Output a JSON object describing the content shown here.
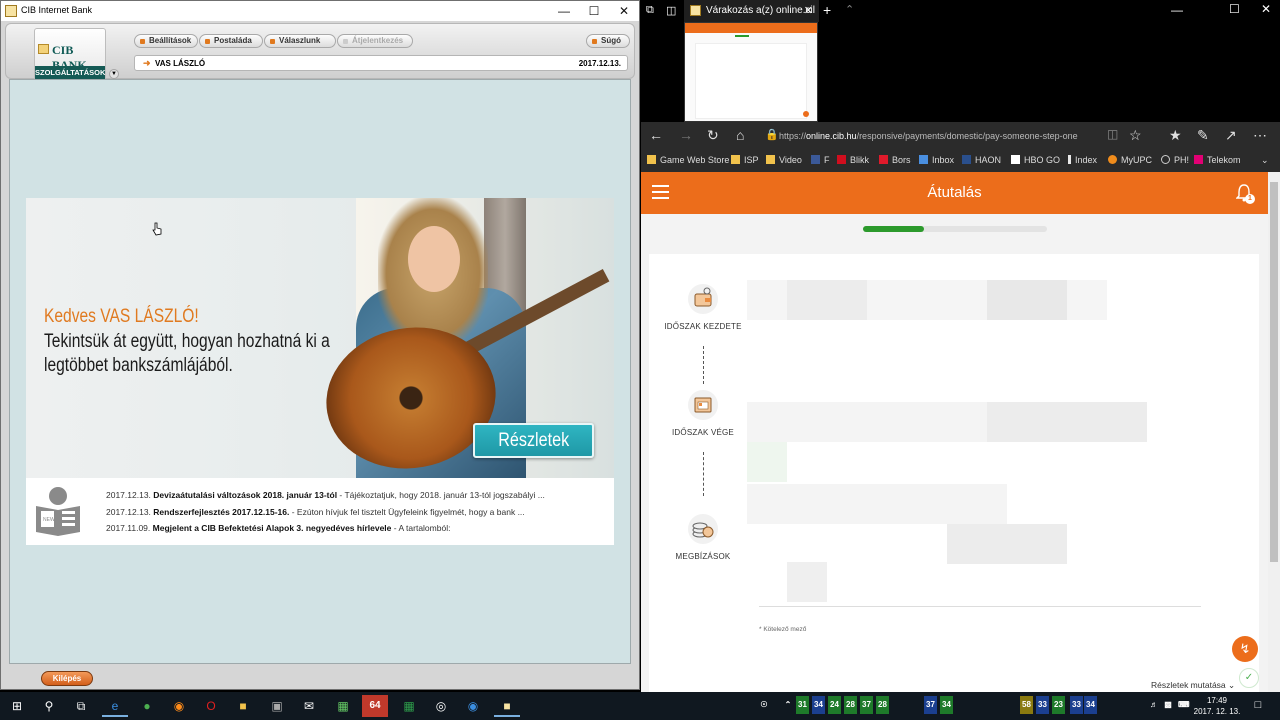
{
  "left_window": {
    "title": "CIB Internet Bank",
    "logo": {
      "brand": "CIB BANK",
      "subtitle": "SZOLGÁLTATÁSOK"
    },
    "nav": [
      "Beállítások",
      "Postaláda",
      "Válaszlunk",
      "Átjelentkezés",
      "Súgó"
    ],
    "user_name": "VAS LÁSZLÓ",
    "date": "2017.12.13.",
    "banner": {
      "greeting": "Kedves VAS LÁSZLÓ!",
      "message": "Tekintsük át együtt, hogyan hozhatná ki a legtöbbet bankszámlájából.",
      "cta": "Részletek"
    },
    "news": [
      {
        "date": "2017.12.13.",
        "title": "Devizaátutalási változások 2018. január 13-tól",
        "text": " - Tájékoztatjuk, hogy 2018. január 13-tól jogszabályi ..."
      },
      {
        "date": "2017.12.13.",
        "title": "Rendszerfejlesztés 2017.12.15-16.",
        "text": " - Ezúton hívjuk fel tisztelt Ügyfeleink figyelmét, hogy a bank ..."
      },
      {
        "date": "2017.11.09.",
        "title": "Megjelent a CIB Befektetési Alapok 3. negyedéves hírlevele",
        "text": " - A tartalomból:"
      }
    ],
    "news_icon_label": "NEWS",
    "logout": "Kilépés"
  },
  "browser": {
    "tab_title": "Várakozás a(z) online.cil",
    "url_host": "online.cib.hu",
    "url_path": "/responsive/payments/domestic/pay-someone-step-one",
    "url_prefix": "https://",
    "favorites": [
      "Game Web Store",
      "ISP",
      "Video",
      "F",
      "Blikk",
      "Bors",
      "Inbox",
      "HAON",
      "HBO GO",
      "Index",
      "MyUPC",
      "PH!",
      "Telekom"
    ]
  },
  "page": {
    "title": "Átutalás",
    "notification_count": "1",
    "progress": 0.33,
    "steps": [
      "IDŐSZAK KEZDETE",
      "IDŐSZAK VÉGE",
      "MEGBÍZÁSOK"
    ],
    "required_note": "* Kötelező mező",
    "details_toggle": "Részletek mutatása"
  },
  "taskbar": {
    "tray_numbers": [
      "31",
      "34",
      "24",
      "28",
      "37",
      "28",
      "37",
      "34",
      "58",
      "33",
      "23",
      "33",
      "34"
    ],
    "time": "17:49",
    "date": "2017. 12. 13."
  }
}
